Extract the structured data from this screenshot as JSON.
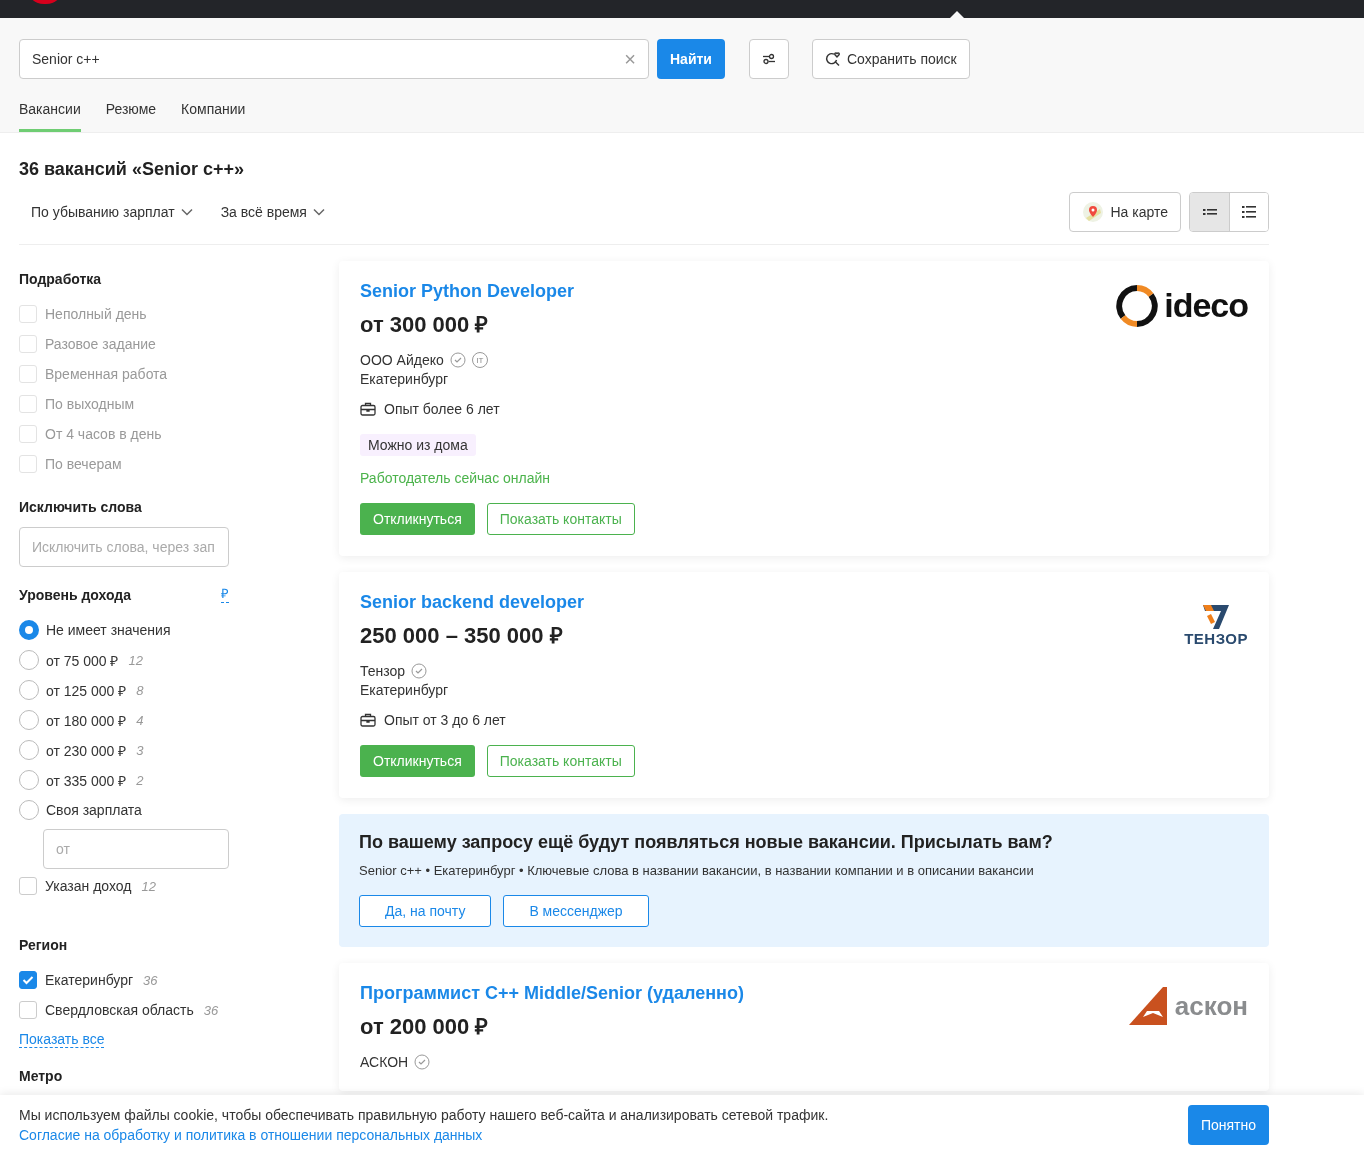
{
  "search": {
    "value": "Senior c++",
    "clear": "×",
    "submit": "Найти",
    "save": "Сохранить поиск"
  },
  "tabs": [
    {
      "label": "Вакансии",
      "selected": true
    },
    {
      "label": "Резюме",
      "selected": false
    },
    {
      "label": "Компании",
      "selected": false
    }
  ],
  "results_title": "36 вакансий «Senior c++»",
  "sorts": [
    "По убыванию зарплат",
    "За всё время"
  ],
  "map_button": "На карте",
  "view_modes": [
    {
      "kind": "compact",
      "selected": true
    },
    {
      "kind": "list",
      "selected": false
    }
  ],
  "sidebar": {
    "part_time": {
      "title": "Подработка",
      "items": [
        {
          "label": "Неполный день",
          "checked": false,
          "disabled": true
        },
        {
          "label": "Разовое задание",
          "checked": false,
          "disabled": true
        },
        {
          "label": "Временная работа",
          "checked": false,
          "disabled": true
        },
        {
          "label": "По выходным",
          "checked": false,
          "disabled": true
        },
        {
          "label": "От 4 часов в день",
          "checked": false,
          "disabled": true
        },
        {
          "label": "По вечерам",
          "checked": false,
          "disabled": true
        }
      ]
    },
    "exclude": {
      "title": "Исключить слова",
      "placeholder": "Исключить слова, через зап"
    },
    "income": {
      "title": "Уровень дохода",
      "currency": "₽",
      "options": [
        {
          "label": "Не имеет значения",
          "selected": true
        },
        {
          "label": "от 75 000 ₽",
          "count": "12",
          "selected": false
        },
        {
          "label": "от 125 000 ₽",
          "count": "8",
          "selected": false
        },
        {
          "label": "от 180 000 ₽",
          "count": "4",
          "selected": false
        },
        {
          "label": "от 230 000 ₽",
          "count": "3",
          "selected": false
        },
        {
          "label": "от 335 000 ₽",
          "count": "2",
          "selected": false
        },
        {
          "label": "Своя зарплата",
          "selected": false
        }
      ],
      "custom_placeholder": "от",
      "specified": {
        "label": "Указан доход",
        "count": "12",
        "checked": false
      }
    },
    "region": {
      "title": "Регион",
      "items": [
        {
          "label": "Екатеринбург",
          "count": "36",
          "checked": true
        },
        {
          "label": "Свердловская область",
          "count": "36",
          "checked": false
        }
      ],
      "show_all": "Показать все"
    },
    "metro": {
      "title": "Метро"
    }
  },
  "results": [
    {
      "kind": "vacancy",
      "title": "Senior Python Developer",
      "salary": "от 300 000 ₽",
      "company": "ООО Айдеко",
      "verified": true,
      "it_badge": "IT",
      "city": "Екатеринбург",
      "experience": "Опыт более 6 лет",
      "tag": "Можно из дома",
      "online": "Работодатель сейчас онлайн",
      "buttons": [
        "Откликнуться",
        "Показать контакты"
      ],
      "logo": {
        "kind": "ring",
        "text": "ideco"
      }
    },
    {
      "kind": "vacancy",
      "title": "Senior backend developer",
      "salary": "250 000 – 350 000 ₽",
      "company": "Тензор",
      "verified": true,
      "city": "Екатеринбург",
      "experience": "Опыт от 3 до 6 лет",
      "buttons": [
        "Откликнуться",
        "Показать контакты"
      ],
      "logo": {
        "kind": "seven",
        "text": "ТЕНЗОР"
      }
    },
    {
      "kind": "subscribe",
      "title": "По вашему запросу ещё будут появляться новые вакансии. Присылать вам?",
      "text": "Senior c++ • Екатеринбург • Ключевые слова в названии вакансии, в названии компании и в описании вакансии",
      "buttons": [
        "Да, на почту",
        "В мессенджер"
      ]
    },
    {
      "kind": "vacancy",
      "title": "Программист C++ Middle/Senior (удаленно)",
      "salary": "от 200 000 ₽",
      "company": "АСКОН",
      "verified": true,
      "logo": {
        "kind": "triangle",
        "text": "аскон"
      }
    }
  ],
  "cookie": {
    "text": "Мы используем файлы cookie, чтобы обеспечивать правильную работу нашего веб-сайта и анализировать сетевой трафик.",
    "link": "Согласие на обработку и политика в отношении персональных данных",
    "button": "Понятно"
  }
}
